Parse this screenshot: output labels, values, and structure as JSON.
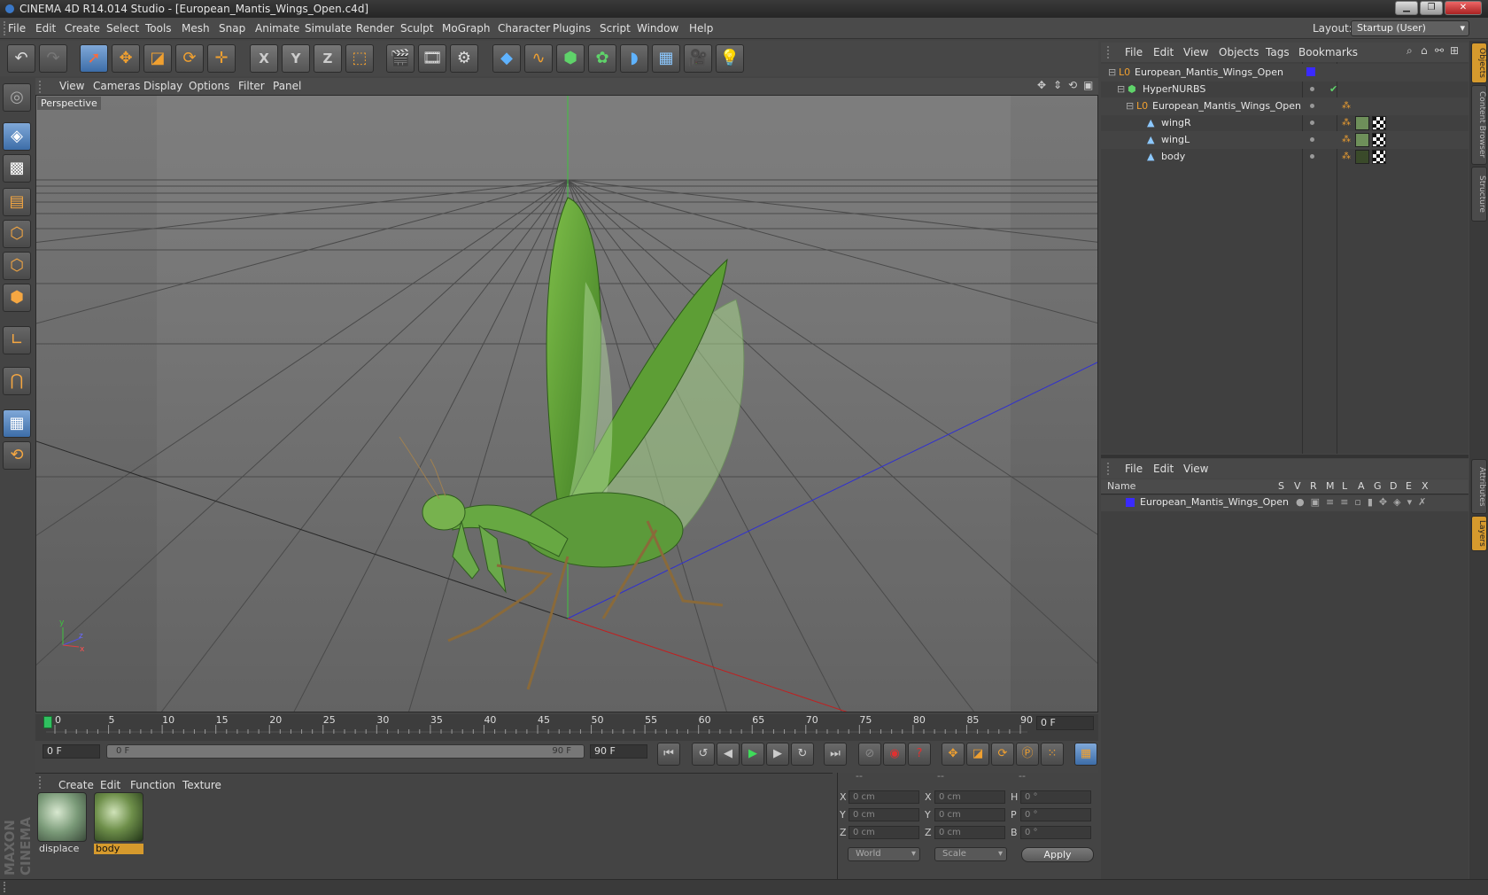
{
  "window": {
    "title": "CINEMA 4D R14.014 Studio - [European_Mantis_Wings_Open.c4d]"
  },
  "menubar": [
    "File",
    "Edit",
    "Create",
    "Select",
    "Tools",
    "Mesh",
    "Snap",
    "Animate",
    "Simulate",
    "Render",
    "Sculpt",
    "MoGraph",
    "Character",
    "Plugins",
    "Script",
    "Window",
    "Help"
  ],
  "layout": {
    "label": "Layout:",
    "value": "Startup (User)"
  },
  "toolbar": {
    "x": "X",
    "y": "Y",
    "z": "Z"
  },
  "viewport": {
    "menu": [
      "View",
      "Cameras",
      "Display",
      "Options",
      "Filter",
      "Panel"
    ],
    "label": "Perspective"
  },
  "timeline": {
    "ticks": [
      "0",
      "5",
      "10",
      "15",
      "20",
      "25",
      "30",
      "35",
      "40",
      "45",
      "50",
      "55",
      "60",
      "65",
      "70",
      "75",
      "80",
      "85",
      "90"
    ],
    "current_frame": "0 F",
    "start_field": "0 F",
    "range_start": "0 F",
    "range_end": "90 F",
    "end_field": "90 F"
  },
  "materials": {
    "menu": [
      "Create",
      "Edit",
      "Function",
      "Texture"
    ],
    "items": [
      {
        "name": "displace",
        "selected": false
      },
      {
        "name": "body",
        "selected": true
      }
    ]
  },
  "coords": {
    "headers": [
      "--",
      "--",
      "--"
    ],
    "rows": [
      {
        "a": "X",
        "av": "0 cm",
        "b": "X",
        "bv": "0 cm",
        "c": "H",
        "cv": "0 °"
      },
      {
        "a": "Y",
        "av": "0 cm",
        "b": "Y",
        "bv": "0 cm",
        "c": "P",
        "cv": "0 °"
      },
      {
        "a": "Z",
        "av": "0 cm",
        "b": "Z",
        "bv": "0 cm",
        "c": "B",
        "cv": "0 °"
      }
    ],
    "world": "World",
    "scale": "Scale",
    "apply": "Apply"
  },
  "object_manager": {
    "menu": [
      "File",
      "Edit",
      "View",
      "Objects",
      "Tags",
      "Bookmarks"
    ],
    "objects": [
      {
        "name": "European_Mantis_Wings_Open",
        "level": 0
      },
      {
        "name": "HyperNURBS",
        "level": 1
      },
      {
        "name": "European_Mantis_Wings_Open",
        "level": 2
      },
      {
        "name": "wingR",
        "level": 3
      },
      {
        "name": "wingL",
        "level": 3
      },
      {
        "name": "body",
        "level": 3
      }
    ]
  },
  "layer_manager": {
    "menu": [
      "File",
      "Edit",
      "View"
    ],
    "columns": [
      "Name",
      "S",
      "V",
      "R",
      "M",
      "L",
      "A",
      "G",
      "D",
      "E",
      "X"
    ],
    "layers": [
      {
        "name": "European_Mantis_Wings_Open",
        "color": "#3a2aff"
      }
    ]
  },
  "right_tabs": [
    "Objects",
    "Content Browser",
    "Structure",
    "Attributes",
    "Layers"
  ],
  "branding": "MAXON CINEMA 4D",
  "colors": {
    "accent": "#d69a2d",
    "selection": "#4a7ab8",
    "layer": "#3a2aff"
  }
}
